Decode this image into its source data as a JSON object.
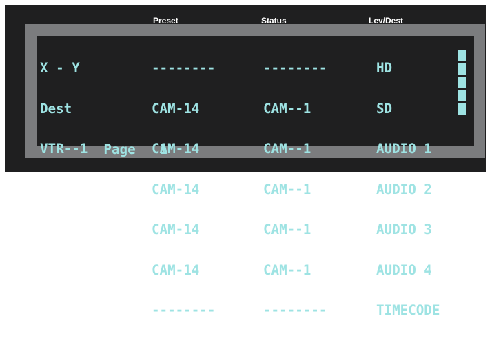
{
  "header": {
    "preset": "Preset",
    "status": "Status",
    "lev_dest": "Lev/Dest"
  },
  "left": {
    "rows": [
      "X - Y",
      "Dest",
      "VTR--1"
    ],
    "page_label": "Page",
    "page_number": "1"
  },
  "preset": {
    "rows": [
      "--------",
      "CAM-14",
      "CAM-14",
      "CAM-14",
      "CAM-14",
      "CAM-14",
      "--------"
    ]
  },
  "status": {
    "rows": [
      "--------",
      "CAM--1",
      "CAM--1",
      "CAM--1",
      "CAM--1",
      "CAM--1",
      "--------"
    ]
  },
  "lev_dest": {
    "rows": [
      "HD",
      "SD",
      "AUDIO 1",
      "AUDIO 2",
      "AUDIO 3",
      "AUDIO 4",
      "TIMECODE"
    ],
    "selected_levels": [
      "SD",
      "AUDIO 1",
      "AUDIO 2",
      "AUDIO 3",
      "AUDIO 4"
    ]
  },
  "colors": {
    "text": "#9ee3e3",
    "screen_bg": "#1f1f20",
    "bezel": "#7b7c7e",
    "header_text": "#ffffff"
  }
}
